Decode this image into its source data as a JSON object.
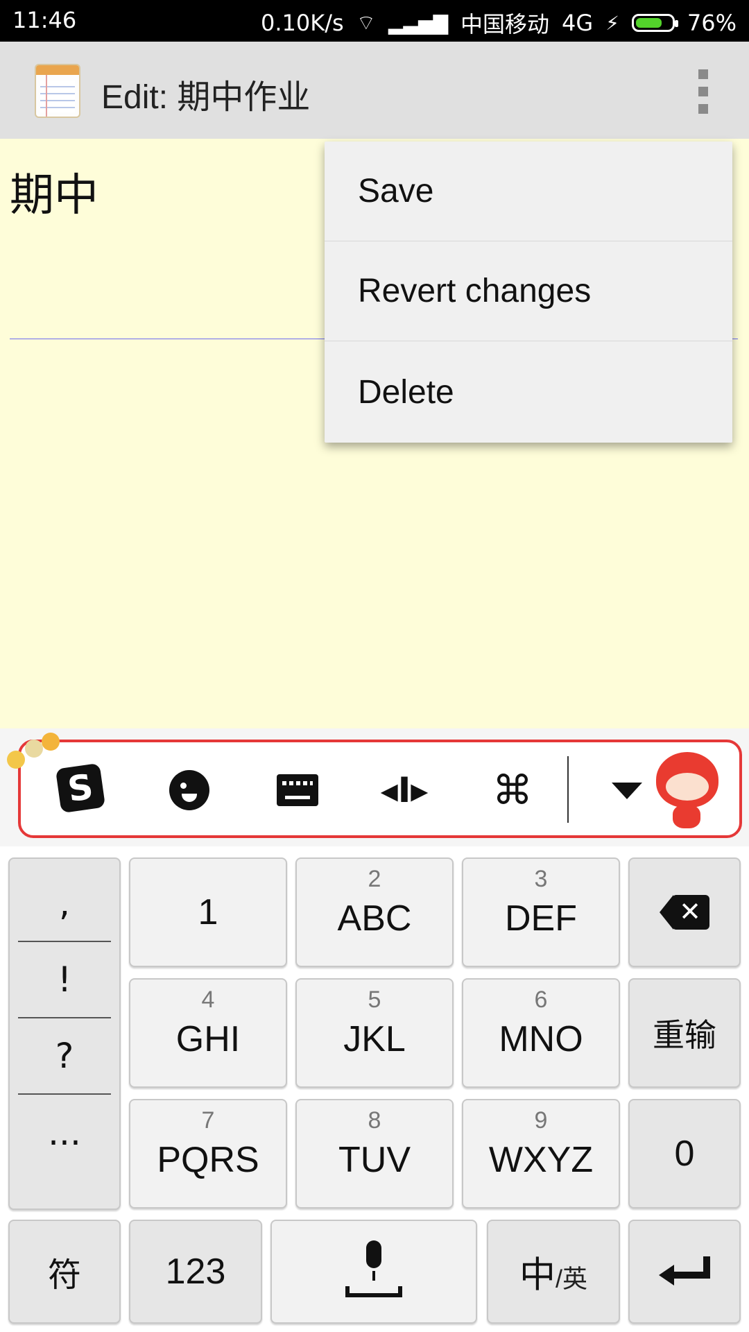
{
  "status_bar": {
    "time": "11:46",
    "net_speed": "0.10K/s",
    "carrier": "中国移动",
    "network_type": "4G",
    "battery_percent": "76%",
    "battery_level": 0.76,
    "battery_color": "#53d32b"
  },
  "action_bar": {
    "title": "Edit: 期中作业",
    "app_icon": "notepad-icon",
    "overflow_icon": "more-vertical-icon"
  },
  "editor": {
    "text": "期中",
    "background_color": "#fefdd9"
  },
  "menu": {
    "items": [
      {
        "label": "Save"
      },
      {
        "label": "Revert changes"
      },
      {
        "label": "Delete"
      }
    ]
  },
  "keyboard_toolbar": {
    "icons": [
      "sogou-logo-icon",
      "emoji-icon",
      "keyboard-icon",
      "cursor-move-icon",
      "command-icon",
      "collapse-arrow-icon",
      "mascot-icon"
    ],
    "cursor_glyph": "◂I▸",
    "command_glyph": "⌘",
    "logo_letter": "S",
    "frame_color": "#e53838"
  },
  "keyboard": {
    "punctuation": [
      ",",
      "!",
      "?",
      "..."
    ],
    "keys": {
      "k1": {
        "label": "1"
      },
      "k2": {
        "num": "2",
        "label": "ABC"
      },
      "k3": {
        "num": "3",
        "label": "DEF"
      },
      "k4": {
        "num": "4",
        "label": "GHI"
      },
      "k5": {
        "num": "5",
        "label": "JKL"
      },
      "k6": {
        "num": "6",
        "label": "MNO"
      },
      "k7": {
        "num": "7",
        "label": "PQRS"
      },
      "k8": {
        "num": "8",
        "label": "TUV"
      },
      "k9": {
        "num": "9",
        "label": "WXYZ"
      },
      "k0": {
        "label": "0"
      }
    },
    "retype_label": "重输",
    "symbol_label": "符",
    "numeric_label": "123",
    "lang_main": "中",
    "lang_sub": "/英",
    "backspace_icon": "backspace-icon",
    "mic_icon": "microphone-icon",
    "enter_icon": "enter-icon"
  }
}
